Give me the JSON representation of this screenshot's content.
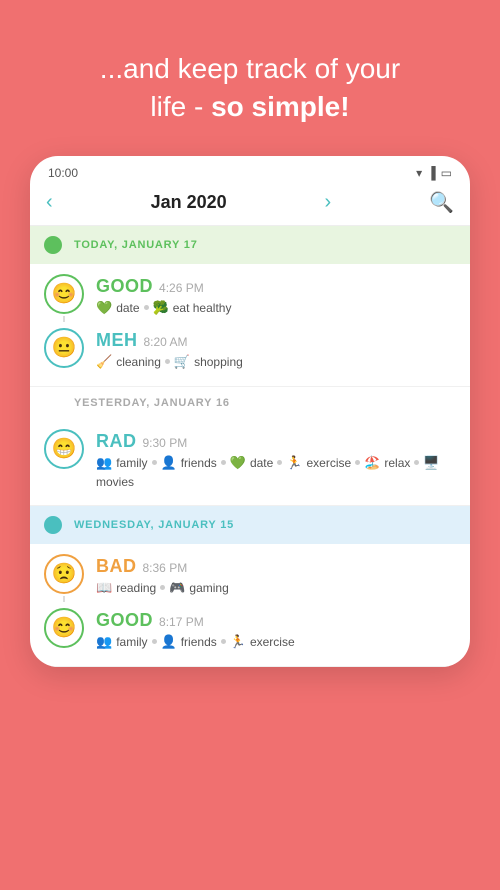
{
  "header": {
    "line1": "...and keep track of your",
    "line2_normal": "life - ",
    "line2_bold": "so simple!"
  },
  "phone": {
    "status_time": "10:00",
    "nav": {
      "month": "Jan 2020",
      "prev_arrow": "‹",
      "next_arrow": "›",
      "search_icon": "search"
    },
    "days": [
      {
        "id": "today",
        "header_style": "today",
        "label": "TODAY, JANUARY 17",
        "label_style": "green",
        "dot_style": "green",
        "entries": [
          {
            "mood": "GOOD",
            "mood_style": "good",
            "time": "4:26 PM",
            "tags": [
              {
                "icon": "💚",
                "text": "date"
              },
              {
                "icon": "🥦",
                "text": "eat healthy"
              }
            ]
          },
          {
            "mood": "MEH",
            "mood_style": "meh",
            "time": "8:20 AM",
            "tags": [
              {
                "icon": "🧹",
                "text": "cleaning"
              },
              {
                "icon": "🛒",
                "text": "shopping"
              }
            ]
          }
        ]
      },
      {
        "id": "yesterday",
        "header_style": "plain",
        "label": "YESTERDAY, JANUARY 16",
        "label_style": "gray",
        "dot_style": "none",
        "entries": [
          {
            "mood": "RAD",
            "mood_style": "rad",
            "time": "9:30 PM",
            "tags": [
              {
                "icon": "👥",
                "text": "family"
              },
              {
                "icon": "👤",
                "text": "friends"
              },
              {
                "icon": "💚",
                "text": "date"
              },
              {
                "icon": "🏃",
                "text": "exercise"
              },
              {
                "icon": "🏖️",
                "text": "relax"
              },
              {
                "icon": "🖥️",
                "text": "movies"
              }
            ]
          }
        ]
      },
      {
        "id": "wednesday",
        "header_style": "wednesday",
        "label": "WEDNESDAY, JANUARY 15",
        "label_style": "blue",
        "dot_style": "blue",
        "entries": [
          {
            "mood": "BAD",
            "mood_style": "bad",
            "time": "8:36 PM",
            "tags": [
              {
                "icon": "📖",
                "text": "reading"
              },
              {
                "icon": "🎮",
                "text": "gaming"
              }
            ]
          },
          {
            "mood": "GOOD",
            "mood_style": "good",
            "time": "8:17 PM",
            "tags": [
              {
                "icon": "👥",
                "text": "family"
              },
              {
                "icon": "👤",
                "text": "friends"
              },
              {
                "icon": "🏃",
                "text": "exercise"
              }
            ]
          }
        ]
      }
    ]
  }
}
